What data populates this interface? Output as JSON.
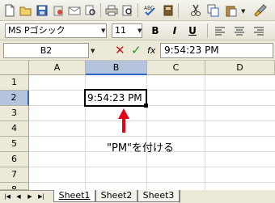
{
  "toolbar": {
    "font_name": "MS Pゴシック",
    "font_size": "11",
    "bold_label": "B",
    "italic_label": "I",
    "underline_label": "U"
  },
  "formula_bar": {
    "name_box": "B2",
    "fx_label": "fx",
    "formula_value": "9:54:23  PM"
  },
  "grid": {
    "columns": [
      "A",
      "B",
      "C",
      "D"
    ],
    "rows": [
      "1",
      "2",
      "3",
      "4",
      "5",
      "6",
      "7",
      "8",
      "9"
    ],
    "active_cell": "B2",
    "active_cell_value": "9:54:23  PM"
  },
  "annotation": {
    "text": "\"PM\"を付ける",
    "arrow_color": "#e3001b"
  },
  "sheets": [
    "Sheet1",
    "Sheet2",
    "Sheet3"
  ],
  "colors": {
    "selection_border": "#000000",
    "header_highlight": "#b5c4dd"
  }
}
